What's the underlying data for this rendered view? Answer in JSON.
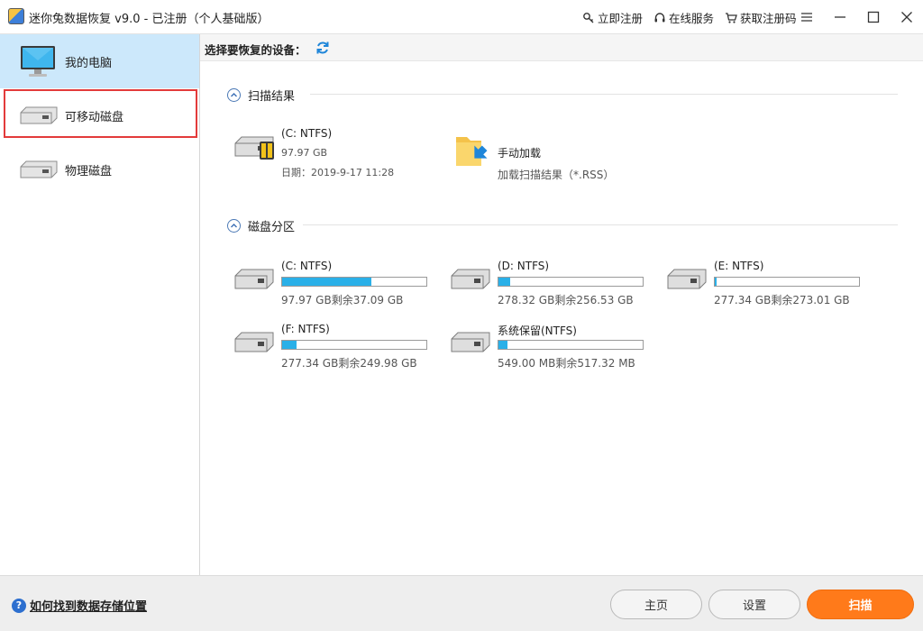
{
  "window": {
    "title": "迷你兔数据恢复 v9.0 - 已注册（个人基础版）",
    "links": [
      {
        "label": "立即注册",
        "icon": "key-icon"
      },
      {
        "label": "在线服务",
        "icon": "headset-icon"
      },
      {
        "label": "获取注册码",
        "icon": "cart-icon"
      }
    ]
  },
  "sidebar": {
    "items": [
      {
        "label": "我的电脑",
        "icon": "computer-icon"
      },
      {
        "label": "可移动磁盘",
        "icon": "disk-icon"
      },
      {
        "label": "物理磁盘",
        "icon": "disk-icon"
      }
    ]
  },
  "toolbar": {
    "label": "选择要恢复的设备："
  },
  "scan_results": {
    "title": "扫描结果",
    "items": [
      {
        "name": "(C: NTFS)",
        "size": "97.97 GB",
        "date": "日期：2019-9-17 11:28"
      },
      {
        "name": "手动加载",
        "sub": "加载扫描结果（*.RSS）"
      }
    ]
  },
  "partitions": {
    "title": "磁盘分区",
    "items": [
      {
        "name": "(C: NTFS)",
        "info": "97.97 GB剩余37.09 GB",
        "used_fraction": 0.62
      },
      {
        "name": "(D: NTFS)",
        "info": "278.32 GB剩余256.53 GB",
        "used_fraction": 0.08
      },
      {
        "name": "(E: NTFS)",
        "info": "277.34 GB剩余273.01 GB",
        "used_fraction": 0.015
      },
      {
        "name": "(F: NTFS)",
        "info": "277.34 GB剩余249.98 GB",
        "used_fraction": 0.1
      },
      {
        "name": "系统保留(NTFS)",
        "info": "549.00 MB剩余517.32 MB",
        "used_fraction": 0.06
      }
    ]
  },
  "footer": {
    "help": "如何找到数据存储位置",
    "home": "主页",
    "settings": "设置",
    "scan": "扫描"
  },
  "colors": {
    "accent": "#2ab0e8",
    "selected_bg": "#cce8fb",
    "highlight_border": "#e33b3b",
    "scan_button": "#ff7a1a"
  }
}
